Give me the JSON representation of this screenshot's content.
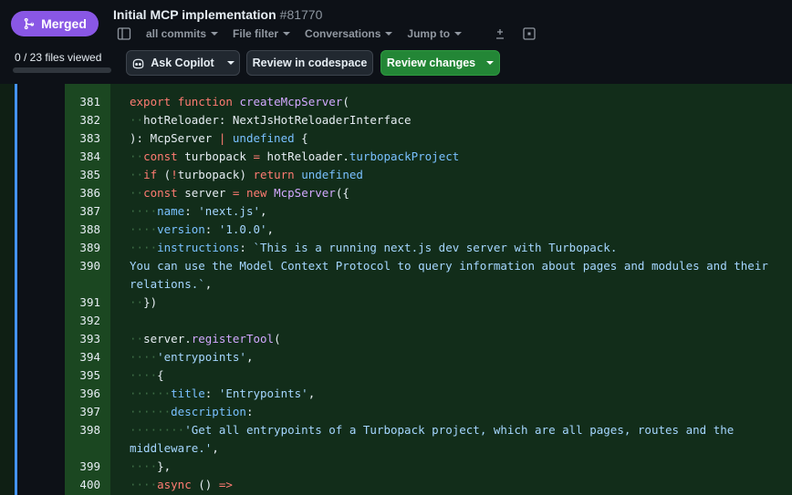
{
  "pr": {
    "status_label": "Merged",
    "title": "Initial MCP implementation",
    "number": "#81770",
    "files_viewed": "0 / 23 files viewed",
    "files_viewed_count": 0,
    "files_total": 23
  },
  "toolbar": {
    "commits": "all commits",
    "file_filter": "File filter",
    "conversations": "Conversations",
    "jump_to": "Jump to"
  },
  "buttons": {
    "ask_copilot": "Ask Copilot",
    "review_codespace": "Review in codespace",
    "review_changes": "Review changes"
  },
  "colors": {
    "merged": "#8957e5",
    "green_button": "#238636",
    "added_line_bg": "#122d1a",
    "added_gutter_bg": "#1b4721"
  },
  "diff": {
    "line_numbers": [
      "381",
      "382",
      "383",
      "384",
      "385",
      "386",
      "387",
      "388",
      "389",
      "390",
      "391",
      "392",
      "393",
      "394",
      "395",
      "396",
      "397",
      "398",
      "399",
      "400"
    ]
  }
}
